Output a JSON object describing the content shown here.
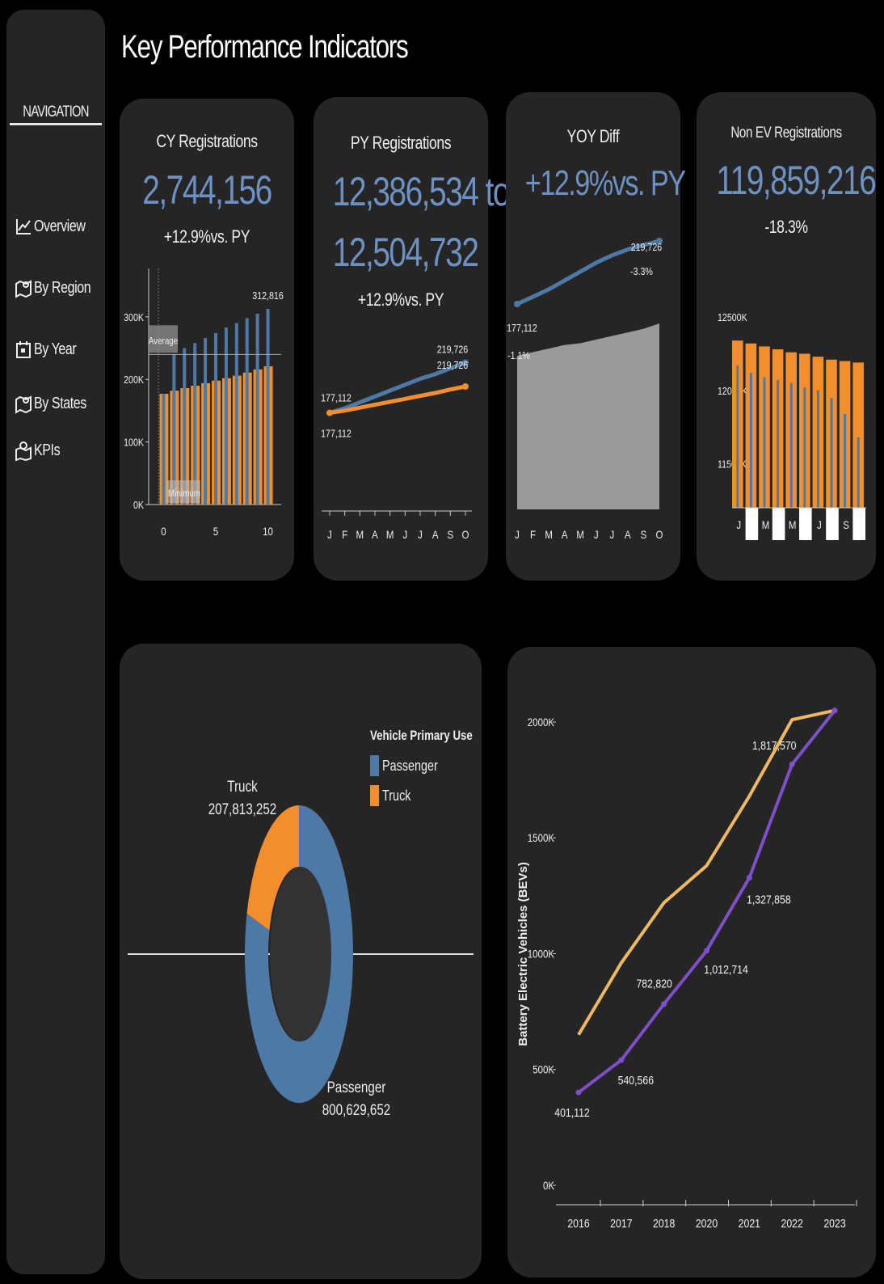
{
  "page_title": "Key Performance Indicators",
  "nav": {
    "title": "NAVIGATION",
    "items": [
      {
        "label": "Overview",
        "icon": "line-chart-icon"
      },
      {
        "label": "By Region",
        "icon": "map-icon"
      },
      {
        "label": "By Year",
        "icon": "calendar-icon"
      },
      {
        "label": "By States",
        "icon": "map-icon"
      },
      {
        "label": "KPIs",
        "icon": "map-pin-icon"
      }
    ]
  },
  "colors": {
    "blue": "#4e79a7",
    "orange": "#f28e2b",
    "purple": "#7f4fc9",
    "gold": "#f0b860",
    "kpi_value": "#6c91c2",
    "card": "#252525"
  },
  "kpis": {
    "cy": {
      "title": "CY Registrations",
      "value": "2,744,156",
      "sub": "+12.9%vs. PY"
    },
    "py": {
      "title": "PY Registrations",
      "value_line1": "12,386,534 to",
      "value_line2": "12,504,732",
      "sub": "+12.9%vs. PY"
    },
    "yoy": {
      "title": "YOY Diff",
      "value": "+12.9%vs. PY"
    },
    "nonev": {
      "title": "Non EV Registrations",
      "value": "119,859,216",
      "sub": "-18.3%"
    }
  },
  "chart_data": [
    {
      "id": "cy",
      "type": "bar",
      "x": [
        0,
        1,
        2,
        3,
        4,
        5,
        6,
        7,
        8,
        9,
        10
      ],
      "series": [
        {
          "color": "blue",
          "values": [
            177000,
            240000,
            250000,
            258000,
            266000,
            274000,
            283000,
            290000,
            298000,
            305000,
            312816
          ]
        },
        {
          "color": "orange",
          "values": [
            177000,
            182000,
            186000,
            190000,
            194000,
            198000,
            202000,
            206000,
            211000,
            216000,
            221000
          ]
        }
      ],
      "reference_lines": [
        {
          "label": "Average",
          "value": 240000
        },
        {
          "label": "Minimum",
          "value": 0
        }
      ],
      "data_labels": [
        {
          "text": "312,816",
          "index": 10
        }
      ],
      "yticks": [
        "0K",
        "100K",
        "200K",
        "300K"
      ],
      "yticks_values": [
        0,
        100000,
        200000,
        300000
      ],
      "xticks": [
        "0",
        "5",
        "10"
      ],
      "xticks_values": [
        0,
        5,
        10
      ],
      "ylim": [
        0,
        380000
      ]
    },
    {
      "id": "py",
      "type": "line",
      "categories": [
        "J",
        "F",
        "M",
        "A",
        "M",
        "J",
        "J",
        "A",
        "S",
        "O"
      ],
      "series": [
        {
          "color": "blue",
          "values": [
            177112,
            181000,
            186000,
            191000,
            196000,
            201000,
            206000,
            210000,
            215000,
            219726
          ]
        },
        {
          "color": "orange",
          "values": [
            177112,
            179000,
            181500,
            184000,
            186500,
            189000,
            191500,
            194000,
            197000,
            199500
          ]
        }
      ],
      "data_labels": [
        {
          "text": "177,112",
          "series": 0,
          "index": 0
        },
        {
          "text": "219,726",
          "series": 0,
          "index": 9
        },
        {
          "text": "219,726",
          "series": 1,
          "index": 9
        },
        {
          "text": "177,112",
          "series": 1,
          "index": 0
        }
      ],
      "ylim": [
        150000,
        260000
      ]
    },
    {
      "id": "yoy",
      "type": "line",
      "categories": [
        "J",
        "F",
        "M",
        "A",
        "M",
        "J",
        "J",
        "A",
        "S",
        "O"
      ],
      "series": [
        {
          "color": "blue",
          "type": "line",
          "values": [
            177112,
            182000,
            187000,
            193000,
            199000,
            205000,
            210000,
            214000,
            217000,
            219726
          ]
        },
        {
          "color": "gray",
          "type": "area",
          "values": [
            -1.1,
            -0.9,
            -0.7,
            -0.5,
            -0.4,
            -0.2,
            0.0,
            0.2,
            0.4,
            0.7
          ]
        }
      ],
      "data_labels": [
        {
          "text": "219,726",
          "series": 0,
          "index": 9
        },
        {
          "text": "-3.3%",
          "series": 0,
          "index": 9
        },
        {
          "text": "177,112",
          "series": 0,
          "index": 0
        },
        {
          "text": "-1.1%",
          "series": 1,
          "index": 0
        }
      ],
      "ylim_line": [
        177112,
        219726
      ]
    },
    {
      "id": "nonev",
      "type": "bar",
      "categories": [
        "J",
        "F",
        "M",
        "A",
        "M",
        "J",
        "J",
        "A",
        "S",
        "O"
      ],
      "xticks": [
        "J",
        "M",
        "M",
        "J",
        "S"
      ],
      "yticks": [
        "11500K",
        "12000K",
        "12500K"
      ],
      "yticks_values": [
        11500000,
        12000000,
        12500000
      ],
      "series": [
        {
          "color": "orange",
          "values": [
            12340000,
            12320000,
            12300000,
            12280000,
            12260000,
            12250000,
            12230000,
            12210000,
            12200000,
            12190000
          ]
        },
        {
          "color": "blue",
          "values": [
            12170000,
            12120000,
            12090000,
            12070000,
            12050000,
            12020000,
            12000000,
            11950000,
            11840000,
            11680000
          ]
        }
      ],
      "ylim": [
        11200000,
        12600000
      ]
    },
    {
      "id": "donut",
      "type": "pie",
      "legend_title": "Vehicle Primary Use",
      "slices": [
        {
          "label": "Passenger",
          "value": 800629652,
          "value_label": "800,629,652",
          "color": "blue"
        },
        {
          "label": "Truck",
          "value": 207813252,
          "value_label": "207,813,252",
          "color": "orange"
        }
      ]
    },
    {
      "id": "bev",
      "type": "line",
      "ylabel": "Battery Electric Vehicles (BEVs)",
      "categories": [
        "2016",
        "2017",
        "2018",
        "2020",
        "2021",
        "2022",
        "2023"
      ],
      "yticks": [
        "0K",
        "500K",
        "1000K",
        "1500K",
        "2000K"
      ],
      "yticks_values": [
        0,
        500000,
        1000000,
        1500000,
        2000000
      ],
      "ylim": [
        0,
        2150000
      ],
      "series": [
        {
          "color": "gold",
          "values": [
            650000,
            960000,
            1220000,
            1380000,
            1680000,
            2010000,
            2050000
          ]
        },
        {
          "color": "purple",
          "values": [
            401112,
            540566,
            782820,
            1012714,
            1327858,
            1817570,
            2050000
          ]
        }
      ],
      "data_labels": [
        {
          "text": "401,112",
          "series": 1,
          "index": 0
        },
        {
          "text": "540,566",
          "series": 1,
          "index": 1
        },
        {
          "text": "782,820",
          "series": 1,
          "index": 2
        },
        {
          "text": "1,012,714",
          "series": 1,
          "index": 3
        },
        {
          "text": "1,327,858",
          "series": 1,
          "index": 4
        },
        {
          "text": "1,817,570",
          "series": 1,
          "index": 5
        }
      ]
    }
  ]
}
